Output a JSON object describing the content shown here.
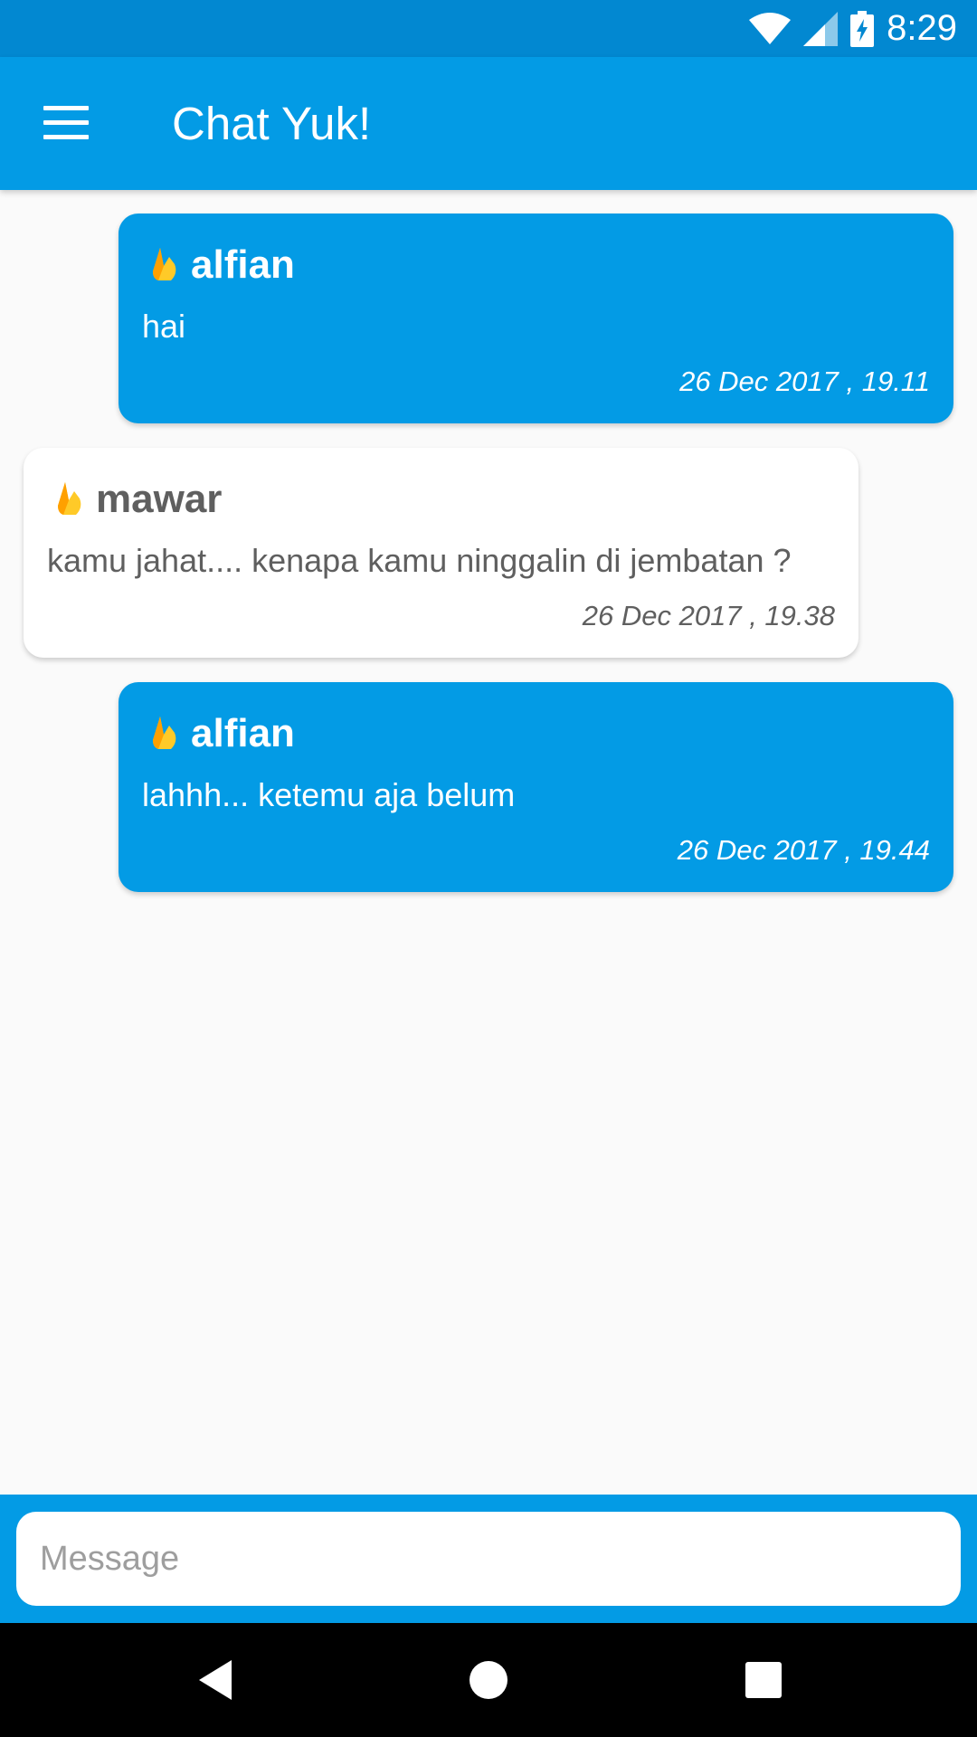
{
  "status_bar": {
    "time": "8:29",
    "icons": [
      "wifi-icon",
      "cell-signal-icon",
      "battery-charging-icon"
    ]
  },
  "app_bar": {
    "title": "Chat Yuk!",
    "menu_icon": "hamburger-menu-icon"
  },
  "messages": [
    {
      "sender": "alfian",
      "text": "hai",
      "time": "26 Dec 2017 , 19.11",
      "own": true
    },
    {
      "sender": "mawar",
      "text": "kamu jahat.... kenapa kamu ninggalin di jembatan ?",
      "time": "26 Dec 2017 , 19.38",
      "own": false
    },
    {
      "sender": "alfian",
      "text": "lahhh... ketemu aja belum",
      "time": "26 Dec 2017 , 19.44",
      "own": true
    }
  ],
  "composer": {
    "placeholder": "Message",
    "value": ""
  },
  "nav_bar": {
    "buttons": [
      "back-icon",
      "home-icon",
      "recents-icon"
    ]
  },
  "colors": {
    "status_bar": "#0288d1",
    "primary": "#039be5",
    "background": "#fafafa",
    "incoming_bubble": "#ffffff",
    "incoming_text": "#5f5f5f",
    "flame_icon": "#ffca28"
  }
}
